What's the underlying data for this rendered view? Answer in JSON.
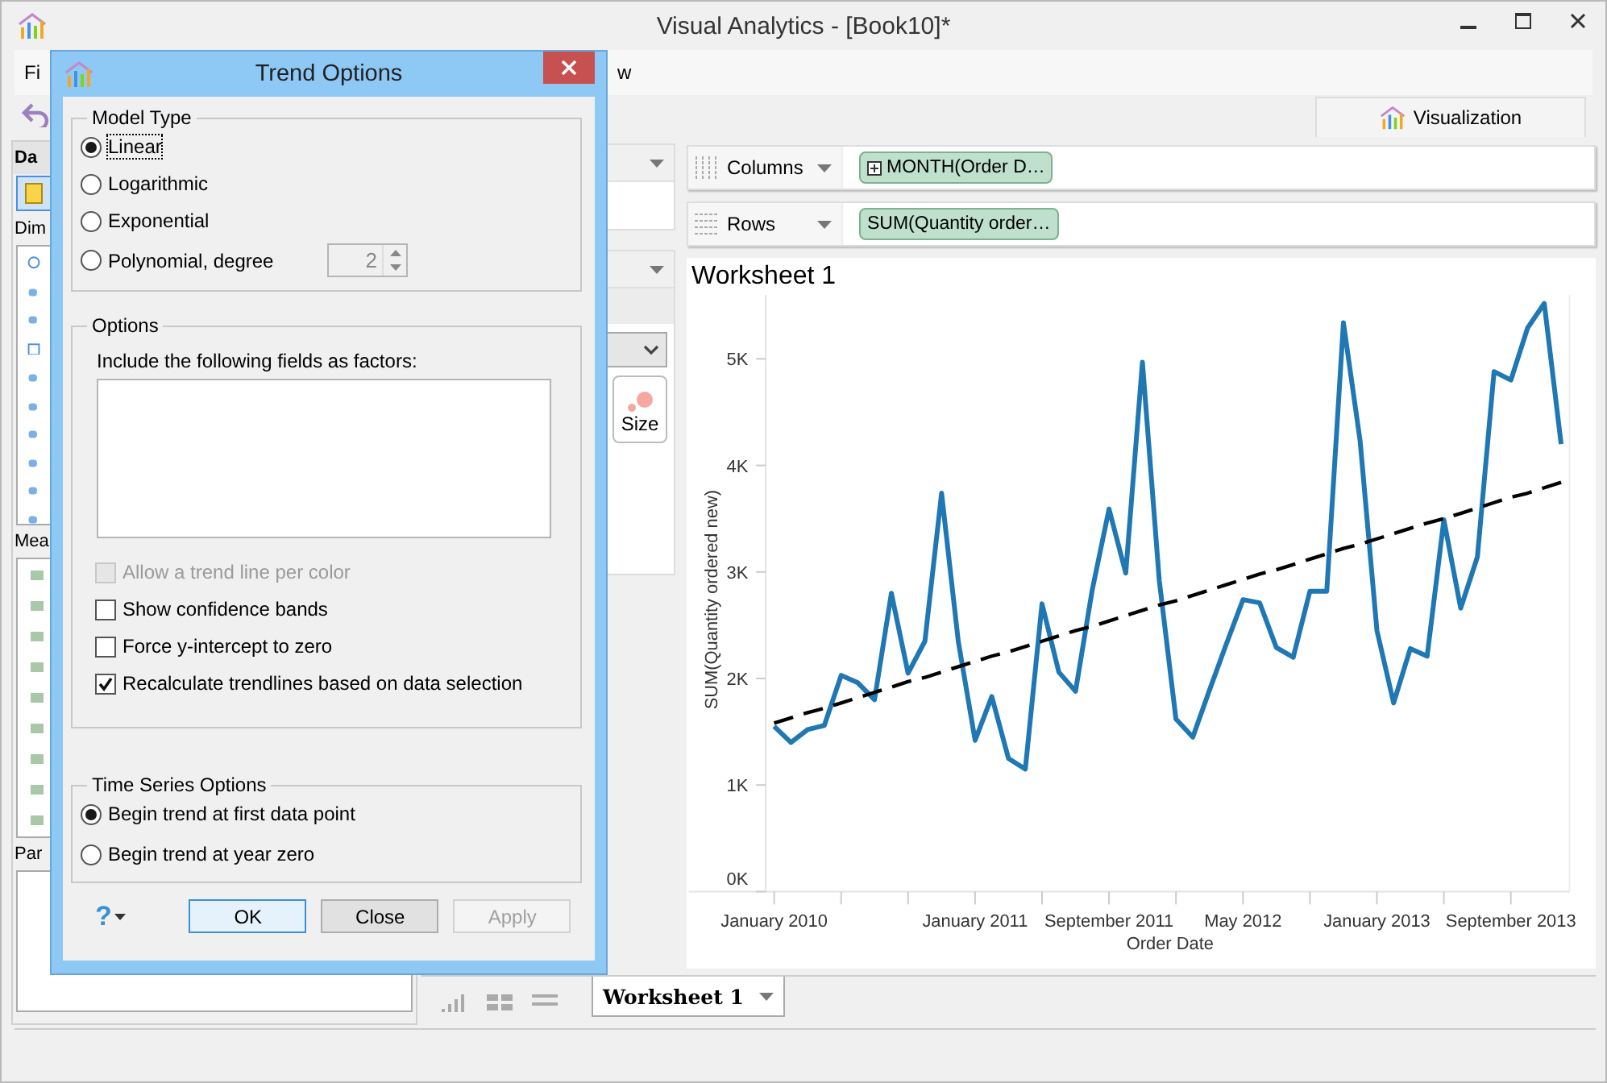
{
  "window": {
    "title": "Visual Analytics - [Book10]*"
  },
  "menu": [
    "Fi",
    "w"
  ],
  "visualization_tab": "Visualization",
  "data_pane": {
    "header": "Da",
    "dimensions_label": "Dim",
    "measures_label": "Mea",
    "parameters_label": "Par"
  },
  "marks": {
    "size_button": "Size"
  },
  "shelves": [
    {
      "label": "Columns",
      "pill": "MONTH(Order D…",
      "expandable": true
    },
    {
      "label": "Rows",
      "pill": "SUM(Quantity order…",
      "expandable": false
    }
  ],
  "worksheet": {
    "title": "Worksheet 1",
    "chart_data": {
      "type": "line",
      "xlabel": "Order Date",
      "ylabel": "SUM(Quantity ordered new)",
      "categories": [
        "January 2010",
        null,
        null,
        null,
        null,
        null,
        null,
        null,
        null,
        null,
        null,
        null,
        "January 2011",
        null,
        null,
        null,
        null,
        null,
        null,
        null,
        "September 2011",
        null,
        null,
        null,
        null,
        null,
        null,
        null,
        "May 2012",
        null,
        null,
        null,
        null,
        null,
        null,
        null,
        "January 2013",
        null,
        null,
        null,
        null,
        null,
        null,
        null,
        "September 2013",
        null,
        null,
        null
      ],
      "series": [
        {
          "color": "#1f77b4",
          "line_style": "solid",
          "values": [
            1550,
            1400,
            1520,
            1560,
            2030,
            1960,
            1800,
            2800,
            2050,
            2350,
            3740,
            2350,
            1420,
            1830,
            1250,
            1150,
            2700,
            2060,
            1880,
            2830,
            3590,
            2990,
            4970,
            2920,
            1620,
            1450,
            1890,
            2320,
            2740,
            2710,
            2290,
            2200,
            2820,
            2820,
            5340,
            4230,
            2450,
            1770,
            2280,
            2210,
            3490,
            2660,
            3140,
            4880,
            4800,
            5290,
            5520,
            4200
          ]
        },
        {
          "color": "#000000",
          "line_style": "dashed",
          "values": [
            1580,
            1630,
            1680,
            1720,
            1770,
            1820,
            1870,
            1920,
            1970,
            2010,
            2060,
            2110,
            2160,
            2210,
            2250,
            2300,
            2350,
            2400,
            2450,
            2490,
            2540,
            2590,
            2640,
            2690,
            2730,
            2780,
            2830,
            2880,
            2930,
            2980,
            3020,
            3070,
            3120,
            3170,
            3220,
            3260,
            3310,
            3360,
            3410,
            3460,
            3500,
            3550,
            3600,
            3650,
            3700,
            3740,
            3790,
            3840
          ]
        }
      ],
      "ylim": [
        0,
        5600
      ],
      "yticks": [
        {
          "value": 0,
          "label": "0K"
        },
        {
          "value": 1000,
          "label": "1K"
        },
        {
          "value": 2000,
          "label": "2K"
        },
        {
          "value": 3000,
          "label": "3K"
        },
        {
          "value": 4000,
          "label": "4K"
        },
        {
          "value": 5000,
          "label": "5K"
        }
      ]
    }
  },
  "sheet_tabs": [
    {
      "label": "Worksheet 1",
      "selected": true
    }
  ],
  "dialog": {
    "title": "Trend Options",
    "model_type": {
      "legend": "Model Type",
      "options": [
        {
          "label": "Linear",
          "selected": true,
          "focused": true
        },
        {
          "label": "Logarithmic",
          "selected": false,
          "focused": false
        },
        {
          "label": "Exponential",
          "selected": false,
          "focused": false
        },
        {
          "label": "Polynomial, degree",
          "selected": false,
          "focused": false
        }
      ],
      "degree": {
        "value": "2",
        "disabled": true
      }
    },
    "options": {
      "legend": "Options",
      "factors_label": "Include the following fields as factors:",
      "checkboxes": [
        {
          "label": "Allow a trend line per color",
          "checked": false,
          "disabled": true
        },
        {
          "label": "Show confidence bands",
          "checked": false,
          "disabled": false
        },
        {
          "label": "Force y-intercept to zero",
          "checked": false,
          "disabled": false
        },
        {
          "label": "Recalculate trendlines based on data selection",
          "checked": true,
          "disabled": false
        }
      ]
    },
    "time_series": {
      "legend": "Time Series Options",
      "options": [
        {
          "label": "Begin trend at first data point",
          "selected": true
        },
        {
          "label": "Begin trend at year zero",
          "selected": false
        }
      ]
    },
    "help": "?",
    "buttons": [
      {
        "label": "OK",
        "kind": "default",
        "disabled": false
      },
      {
        "label": "Close",
        "kind": "normal",
        "disabled": false
      },
      {
        "label": "Apply",
        "kind": "normal",
        "disabled": true
      }
    ]
  }
}
